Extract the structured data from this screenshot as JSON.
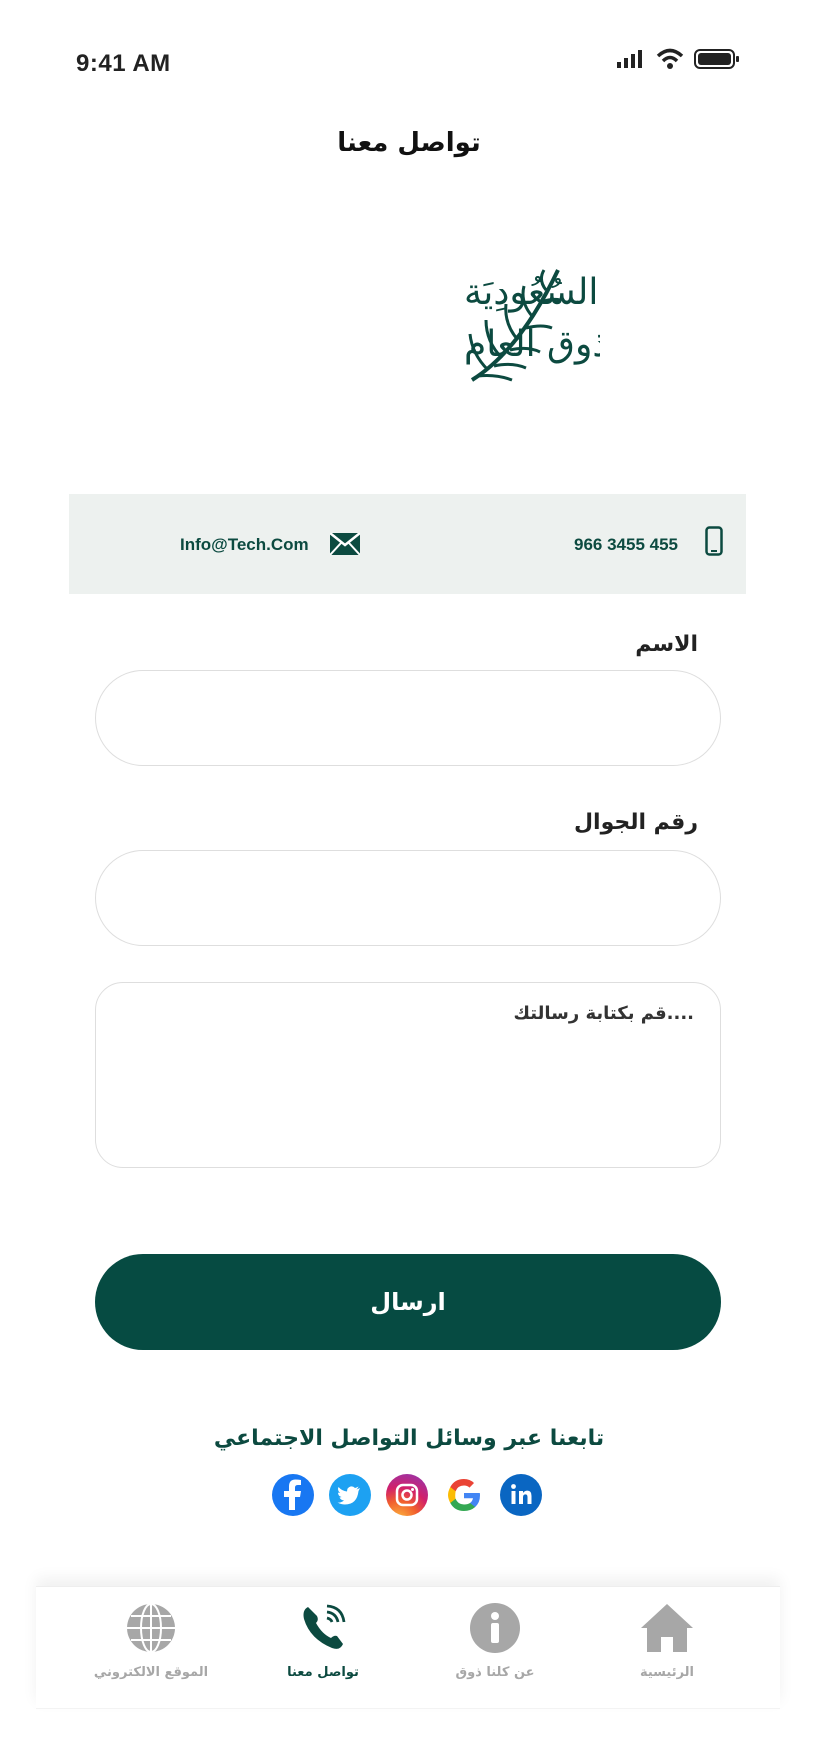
{
  "status_bar": {
    "time": "9:41 AM",
    "icons": [
      "signal-icon",
      "wifi-icon",
      "battery-icon"
    ]
  },
  "header": {
    "title": "تواصل معنا"
  },
  "logo": {
    "line1": "الجَمْعِيَة السُعُودِيَة",
    "line2": "للذوق العام",
    "icon": "palm-leaf-logo"
  },
  "contact": {
    "email": "Info@Tech.Com",
    "phone": "966 3455 455",
    "email_icon": "mail-icon",
    "phone_icon": "mobile-phone-icon"
  },
  "form": {
    "name_label": "الاسم",
    "name_value": "",
    "mobile_label": "رقم الجوال",
    "mobile_value": "",
    "message_placeholder": "....قم بكتابة رسالتك",
    "submit_label": "ارسال"
  },
  "social": {
    "title": "تابعنا عبر وسائل التواصل الاجتماعي",
    "icons": [
      "facebook-icon",
      "twitter-icon",
      "instagram-icon",
      "google-icon",
      "linkedin-icon"
    ]
  },
  "bottom_nav": {
    "items": [
      {
        "label": "الموقع الالكتروني",
        "icon": "globe-icon",
        "active": false
      },
      {
        "label": "تواصل معنا",
        "icon": "phone-call-icon",
        "active": true
      },
      {
        "label": "عن كلنا ذوق",
        "icon": "info-icon",
        "active": false
      },
      {
        "label": "الرئيسية",
        "icon": "home-icon",
        "active": false
      }
    ]
  },
  "colors": {
    "primary": "#064b42",
    "strip": "#edf1ef",
    "inactive": "#a7a7a7"
  }
}
